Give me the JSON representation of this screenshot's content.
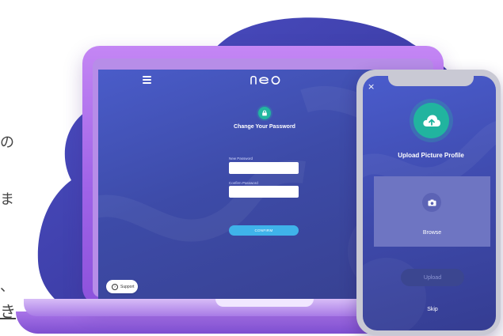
{
  "left_edge_text": [
    "の",
    "ま",
    "、",
    "き"
  ],
  "laptop": {
    "brand": "neo",
    "page_title": "Change Your Password",
    "new_password_label": "New Password",
    "confirm_password_label": "Confirm Password",
    "confirm_button": "CONFIRM",
    "support_label": "Support",
    "support_icon": "?"
  },
  "phone": {
    "close_icon": "×",
    "upload_title": "Upload Picture Profile",
    "browse_label": "Browse",
    "upload_button": "Upload",
    "skip_label": "Skip"
  },
  "colors": {
    "accent_teal": "#21b49f",
    "confirm_blue": "#3fb3ea",
    "device_purple": "#9f63e7",
    "screen_indigo": "#3d4ba8"
  }
}
